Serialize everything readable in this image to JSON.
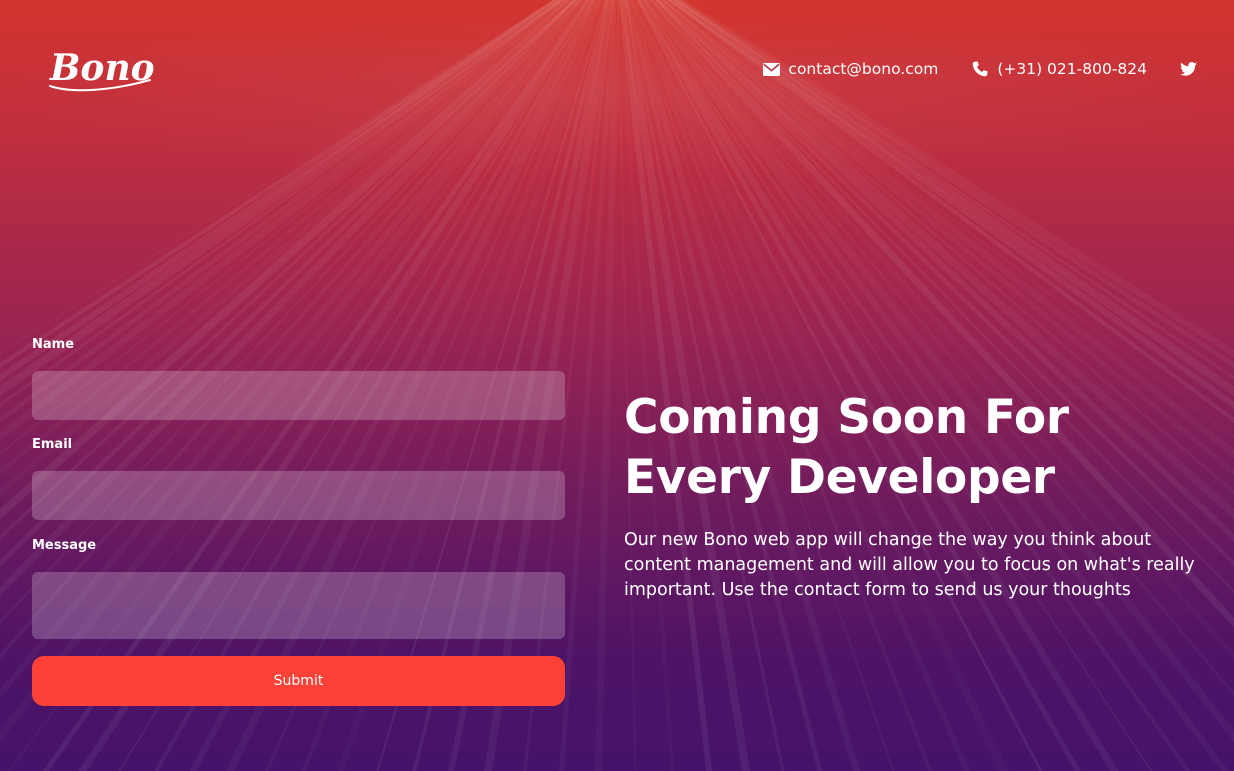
{
  "brand": {
    "logo_text": "Bono"
  },
  "header": {
    "email": "contact@bono.com",
    "phone": "(+31) 021-800-824",
    "icons": {
      "email": "envelope-icon",
      "phone": "phone-icon",
      "social": "twitter-icon"
    }
  },
  "form": {
    "name_label": "Name",
    "name_value": "",
    "email_label": "Email",
    "email_value": "",
    "message_label": "Message",
    "message_value": "",
    "submit_label": "Submit"
  },
  "hero": {
    "title": "Coming Soon For Every Developer",
    "description": "Our new Bono web app will change the way you think about content management and will allow you to focus on what's really important. Use the contact form to send us your thoughts"
  },
  "colors": {
    "gradient_top": "#d3352f",
    "gradient_bottom": "#46136a",
    "accent_button": "#fd4137",
    "text": "#ffffff"
  }
}
